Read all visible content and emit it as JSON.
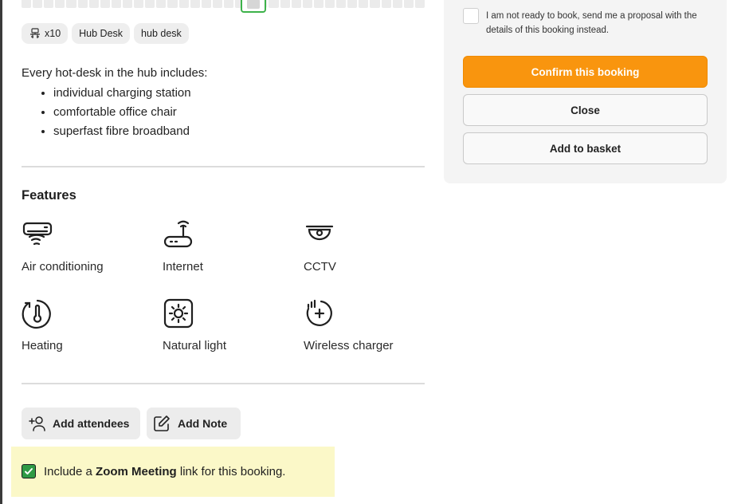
{
  "tags": [
    {
      "icon": "desk-chair-icon",
      "label": "x10"
    },
    {
      "icon": null,
      "label": "Hub Desk"
    },
    {
      "icon": null,
      "label": "hub desk"
    }
  ],
  "description": {
    "intro": "Every hot-desk in the hub includes:",
    "items": [
      "individual charging station",
      "comfortable office chair",
      "superfast fibre broadband"
    ]
  },
  "features": {
    "title": "Features",
    "items": [
      {
        "icon": "air-conditioning-icon",
        "label": "Air conditioning"
      },
      {
        "icon": "router-icon",
        "label": "Internet"
      },
      {
        "icon": "cctv-camera-icon",
        "label": "CCTV"
      },
      {
        "icon": "thermometer-icon",
        "label": "Heating"
      },
      {
        "icon": "sun-icon",
        "label": "Natural light"
      },
      {
        "icon": "wireless-charger-icon",
        "label": "Wireless charger"
      }
    ]
  },
  "actions": {
    "add_attendees": "Add attendees",
    "add_note": "Add Note"
  },
  "zoom": {
    "checked": true,
    "prefix": "Include a ",
    "bold": "Zoom Meeting",
    "suffix": " link for this booking."
  },
  "panel": {
    "proposal_text": "I am not ready to book, send me a proposal with the details of this booking instead.",
    "confirm_label": "Confirm this booking",
    "close_label": "Close",
    "basket_label": "Add to basket"
  },
  "colors": {
    "accent": "#f9950e",
    "check_green": "#2f9a45",
    "highlight": "#fbf8c8"
  }
}
